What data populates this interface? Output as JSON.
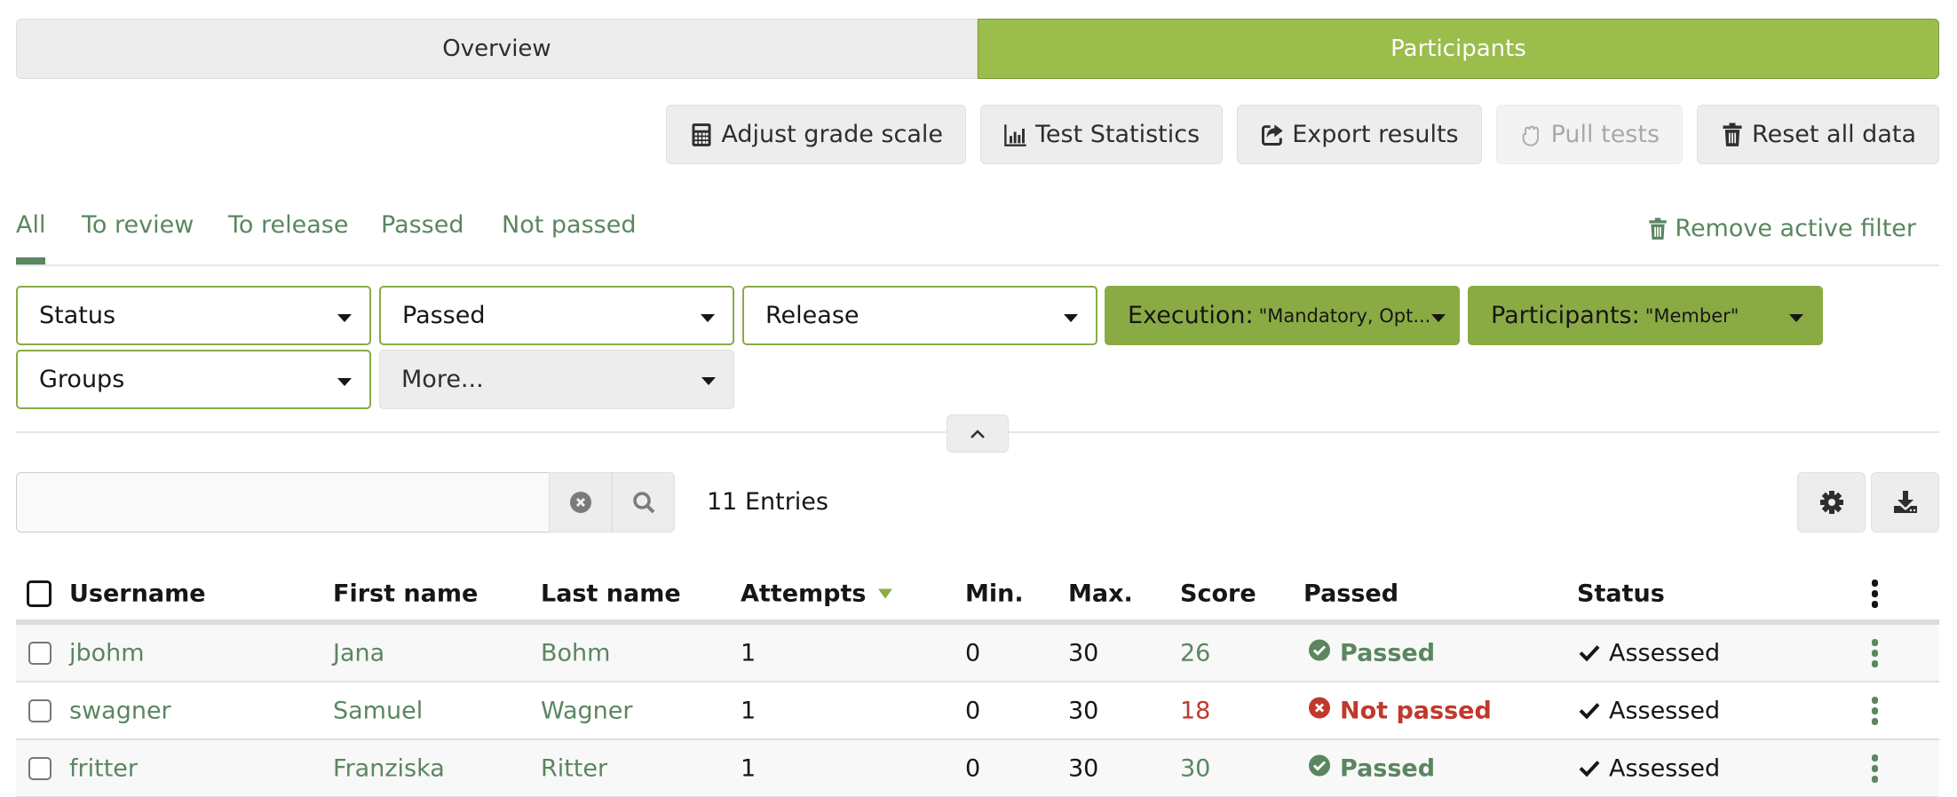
{
  "mode_tabs": [
    {
      "label": "Overview",
      "active": false
    },
    {
      "label": "Participants",
      "active": true
    }
  ],
  "toolbar": {
    "adjust_grade_scale": "Adjust grade scale",
    "test_statistics": "Test Statistics",
    "export_results": "Export results",
    "pull_tests": "Pull tests",
    "reset_all_data": "Reset all data"
  },
  "view_tabs": [
    "All",
    "To review",
    "To release",
    "Passed",
    "Not passed"
  ],
  "active_view_tab": "All",
  "remove_filter_label": "Remove active filter",
  "filters": {
    "status": "Status",
    "passed": "Passed",
    "release": "Release",
    "execution_label": "Execution:",
    "execution_value": "\"Mandatory, Opt...",
    "participants_label": "Participants:",
    "participants_value": "\"Member\"",
    "groups": "Groups",
    "more": "More..."
  },
  "search": {
    "value": "",
    "placeholder": ""
  },
  "entries_count": "11 Entries",
  "colors": {
    "accent_green": "#9abd4c",
    "filter_green": "#8aab44",
    "link_green": "#5a8660",
    "fail_red": "#c0392b"
  },
  "table": {
    "columns": [
      "Username",
      "First name",
      "Last name",
      "Attempts",
      "Min.",
      "Max.",
      "Score",
      "Passed",
      "Status"
    ],
    "sorted_column": "Attempts",
    "rows": [
      {
        "username": "jbohm",
        "first_name": "Jana",
        "last_name": "Bohm",
        "attempts": "1",
        "min": "0",
        "max": "30",
        "score": "26",
        "passed": "Passed",
        "passed_state": "pass",
        "status": "Assessed"
      },
      {
        "username": "swagner",
        "first_name": "Samuel",
        "last_name": "Wagner",
        "attempts": "1",
        "min": "0",
        "max": "30",
        "score": "18",
        "passed": "Not passed",
        "passed_state": "fail",
        "status": "Assessed"
      },
      {
        "username": "fritter",
        "first_name": "Franziska",
        "last_name": "Ritter",
        "attempts": "1",
        "min": "0",
        "max": "30",
        "score": "30",
        "passed": "Passed",
        "passed_state": "pass",
        "status": "Assessed"
      }
    ]
  }
}
